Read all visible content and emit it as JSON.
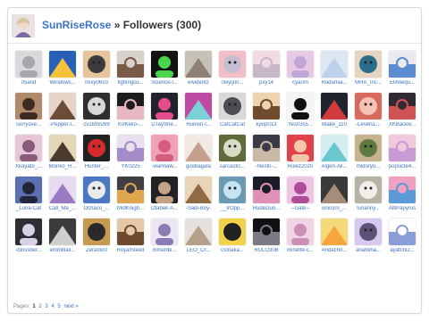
{
  "header": {
    "username": "SunRiseRose",
    "separator": " » ",
    "title": "Followers (300)"
  },
  "followers": [
    {
      "name": "05and",
      "colors": [
        "#d9d9dc",
        "#a7a7ae"
      ]
    },
    {
      "name": "Windows...",
      "colors": [
        "#2a5fb8",
        "#f4c23b"
      ]
    },
    {
      "name": "mixy0610",
      "colors": [
        "#3b3b3b",
        "#e7c39b"
      ]
    },
    {
      "name": "fighingcu...",
      "colors": [
        "#d8d2cb",
        "#7a5a47"
      ]
    },
    {
      "name": "Science-l...",
      "colors": [
        "#121212",
        "#49d64a"
      ]
    },
    {
      "name": "elvidentz",
      "colors": [
        "#c6c2b5",
        "#8e8173"
      ]
    },
    {
      "name": "0wyijon...",
      "colors": [
        "#c4bed3",
        "#f1bdc7"
      ]
    },
    {
      "name": "pxy14",
      "colors": [
        "#f2dbe4",
        "#c6b8c9"
      ]
    },
    {
      "name": "cyanm",
      "colors": [
        "#e8c9e4",
        "#bfa6d6"
      ]
    },
    {
      "name": "Rodamia...",
      "colors": [
        "#dde7f2",
        "#bcd1ea"
      ]
    },
    {
      "name": "MHA_Inc...",
      "colors": [
        "#2a6d8c",
        "#e6d5c0"
      ]
    },
    {
      "name": "EliiVeiqu...",
      "colors": [
        "#e9e9ef",
        "#5b8bd1"
      ]
    },
    {
      "name": "sorryove...",
      "colors": [
        "#b08a6c",
        "#3f2b22"
      ]
    },
    {
      "name": "-Pepper-l...",
      "colors": [
        "#e8d3c7",
        "#6d4c3a"
      ]
    },
    {
      "name": "cv1699269",
      "colors": [
        "#d9d9d9",
        "#2f2f2f"
      ]
    },
    {
      "name": "KoKeko-...",
      "colors": [
        "#1d1d1d",
        "#e9b7c1"
      ]
    },
    {
      "name": "DTayShe...",
      "colors": [
        "#22222a",
        "#e54b8c"
      ]
    },
    {
      "name": "Hunion-l...",
      "colors": [
        "#bf4aa6",
        "#7ad1d6"
      ]
    },
    {
      "name": "CatCatCat",
      "colors": [
        "#4d4d56",
        "#d8d8d8"
      ]
    },
    {
      "name": "kpop013",
      "colors": [
        "#edd4b0",
        "#6f4a2c"
      ]
    },
    {
      "name": "Yes03s5...",
      "colors": [
        "#f4f4f4",
        "#111111"
      ]
    },
    {
      "name": "Blake_110",
      "colors": [
        "#20242e",
        "#d23b3b"
      ]
    },
    {
      "name": "-LevelsL...",
      "colors": [
        "#f5c3b4",
        "#d86a5d"
      ]
    },
    {
      "name": "XKBackw...",
      "colors": [
        "#2f2a33",
        "#d05353"
      ]
    },
    {
      "name": "Xkayato_...",
      "colors": [
        "#e5c6d7",
        "#8a5b7a"
      ]
    },
    {
      "name": "Moriko_R...",
      "colors": [
        "#e6d6b8",
        "#4a3b2e"
      ]
    },
    {
      "name": "Hunter_...",
      "colors": [
        "#d62b2b",
        "#222222"
      ]
    },
    {
      "name": "YK0225",
      "colors": [
        "#e9e0ef",
        "#a58bc9"
      ]
    },
    {
      "name": "-wannaw...",
      "colors": [
        "#f0a2b4",
        "#d55c7e"
      ]
    },
    {
      "name": "goobagala",
      "colors": [
        "#f1e9e4",
        "#c59f8c"
      ]
    },
    {
      "name": "sarcastic...",
      "colors": [
        "#d9dcc5",
        "#5f6b3a"
      ]
    },
    {
      "name": "-hlestri-...",
      "colors": [
        "#393c47",
        "#c9b8a4"
      ]
    },
    {
      "name": "Rulez2020",
      "colors": [
        "#e0414c",
        "#f3c7a7"
      ]
    },
    {
      "name": "Algen-Ali...",
      "colors": [
        "#d4eef1",
        "#6bc7cf"
      ]
    },
    {
      "name": "midoryu...",
      "colors": [
        "#5f7a3f",
        "#c6b28e"
      ]
    },
    {
      "name": "popsicle4...",
      "colors": [
        "#f0c9dd",
        "#c79bd4"
      ]
    },
    {
      "name": "_Luna-Cat",
      "colors": [
        "#5c6fb0",
        "#23253a"
      ]
    },
    {
      "name": "Call_Me_...",
      "colors": [
        "#e6dbef",
        "#9a7ac2"
      ]
    },
    {
      "name": "Ochaco_...",
      "colors": [
        "#eaeaea",
        "#4b78c4"
      ]
    },
    {
      "name": "MidKnigh...",
      "colors": [
        "#3f3f44",
        "#e0a64e"
      ]
    },
    {
      "name": "Otabek-A...",
      "colors": [
        "#222226",
        "#c4a286"
      ]
    },
    {
      "name": "-Sadi-Boy-",
      "colors": [
        "#e9d5b7",
        "#8f6a44"
      ]
    },
    {
      "name": "__IrOpp...",
      "colors": [
        "#c8e3f2",
        "#6a9ab3"
      ]
    },
    {
      "name": "RudeDun...",
      "colors": [
        "#1a1c28",
        "#e08fb7"
      ]
    },
    {
      "name": "--Gate--",
      "colors": [
        "#eec5e2",
        "#b04d9a"
      ]
    },
    {
      "name": "unicorn_...",
      "colors": [
        "#3a3a3a",
        "#a58d7a"
      ]
    },
    {
      "name": "lunanny...",
      "colors": [
        "#f1efe9",
        "#b8b3a4"
      ]
    },
    {
      "name": "AltiPapyrus",
      "colors": [
        "#f0a0c3",
        "#5b9ad6"
      ]
    },
    {
      "name": "-blossber...",
      "colors": [
        "#2d2d33",
        "#d8d1e6"
      ]
    },
    {
      "name": "emmitlak...",
      "colors": [
        "#3b3b3b",
        "#cfcfcf"
      ]
    },
    {
      "name": "Zeraloo0",
      "colors": [
        "#2a2a2e",
        "#c79a52"
      ]
    },
    {
      "name": "RoyalSteed",
      "colors": [
        "#e4c9a8",
        "#6d4a2f"
      ]
    },
    {
      "name": "mmerde...",
      "colors": [
        "#eae6f2",
        "#8d7bb5"
      ]
    },
    {
      "name": "LEO_Cr...",
      "colors": [
        "#e6e1dc",
        "#b5a08a"
      ]
    },
    {
      "name": "Gchaka...",
      "colors": [
        "#222222",
        "#f2d24a"
      ]
    },
    {
      "name": "RULO30B",
      "colors": [
        "#111114",
        "#7b7b84"
      ]
    },
    {
      "name": "minette-c...",
      "colors": [
        "#f1d4e4",
        "#c98fb5"
      ]
    },
    {
      "name": "Andachn...",
      "colors": [
        "#f4d97a",
        "#f7a63f"
      ]
    },
    {
      "name": "anahkha...",
      "colors": [
        "#5b5478",
        "#d9c9ee"
      ]
    },
    {
      "name": "ayatchi2...",
      "colors": [
        "#ffffff",
        "#8a9dd6"
      ]
    }
  ],
  "pager": {
    "label": "Pages:",
    "current": "1",
    "pages": [
      "2",
      "3",
      "4",
      "5"
    ],
    "next": "next »"
  }
}
